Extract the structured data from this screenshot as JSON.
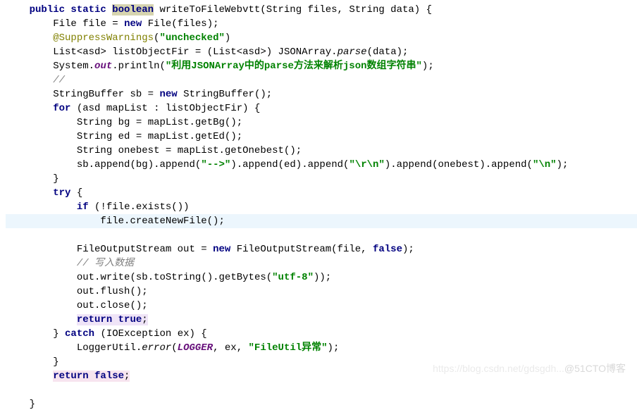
{
  "code": {
    "lines": [
      {
        "indent": "    ",
        "tokens": [
          {
            "t": "public ",
            "c": "kw"
          },
          {
            "t": "static ",
            "c": "kw"
          },
          {
            "t": "boolean",
            "c": "kw selword"
          },
          {
            "t": " ",
            "c": ""
          },
          {
            "t": "writeToFileWebvtt",
            "c": "id"
          },
          {
            "t": "(",
            "c": ""
          },
          {
            "t": "String",
            "c": "id"
          },
          {
            "t": " ",
            "c": ""
          },
          {
            "t": "files",
            "c": "id"
          },
          {
            "t": ", ",
            "c": ""
          },
          {
            "t": "String",
            "c": "id"
          },
          {
            "t": " ",
            "c": ""
          },
          {
            "t": "data",
            "c": "id"
          },
          {
            "t": ") {",
            "c": ""
          }
        ]
      },
      {
        "indent": "        ",
        "tokens": [
          {
            "t": "File",
            "c": "id"
          },
          {
            "t": " ",
            "c": ""
          },
          {
            "t": "file",
            "c": "id"
          },
          {
            "t": " = ",
            "c": ""
          },
          {
            "t": "new",
            "c": "kw"
          },
          {
            "t": " ",
            "c": ""
          },
          {
            "t": "File",
            "c": "id"
          },
          {
            "t": "(",
            "c": ""
          },
          {
            "t": "files",
            "c": "id"
          },
          {
            "t": ");",
            "c": ""
          }
        ]
      },
      {
        "indent": "        ",
        "tokens": [
          {
            "t": "@SuppressWarnings",
            "c": "annot"
          },
          {
            "t": "(",
            "c": ""
          },
          {
            "t": "\"unchecked\"",
            "c": "str"
          },
          {
            "t": ")",
            "c": ""
          }
        ]
      },
      {
        "indent": "        ",
        "tokens": [
          {
            "t": "List",
            "c": "id"
          },
          {
            "t": "<",
            "c": ""
          },
          {
            "t": "asd",
            "c": "id"
          },
          {
            "t": "> ",
            "c": ""
          },
          {
            "t": "listObjectFir",
            "c": "id"
          },
          {
            "t": " = (",
            "c": ""
          },
          {
            "t": "List",
            "c": "id"
          },
          {
            "t": "<",
            "c": ""
          },
          {
            "t": "asd",
            "c": "id"
          },
          {
            "t": ">) ",
            "c": ""
          },
          {
            "t": "JSONArray",
            "c": "id"
          },
          {
            "t": ".",
            "c": ""
          },
          {
            "t": "parse",
            "c": "callI"
          },
          {
            "t": "(",
            "c": ""
          },
          {
            "t": "data",
            "c": "id"
          },
          {
            "t": ");",
            "c": ""
          }
        ]
      },
      {
        "indent": "        ",
        "tokens": [
          {
            "t": "System",
            "c": "id"
          },
          {
            "t": ".",
            "c": ""
          },
          {
            "t": "out",
            "c": "staticb"
          },
          {
            "t": ".",
            "c": ""
          },
          {
            "t": "println",
            "c": "call"
          },
          {
            "t": "(",
            "c": ""
          },
          {
            "t": "\"利用JSONArray中的parse方法来解析json数组字符串\"",
            "c": "str"
          },
          {
            "t": ");",
            "c": ""
          }
        ]
      },
      {
        "indent": "        ",
        "tokens": [
          {
            "t": "//",
            "c": "comment"
          }
        ]
      },
      {
        "indent": "        ",
        "tokens": [
          {
            "t": "StringBuffer",
            "c": "id"
          },
          {
            "t": " ",
            "c": ""
          },
          {
            "t": "sb",
            "c": "id"
          },
          {
            "t": " = ",
            "c": ""
          },
          {
            "t": "new",
            "c": "kw"
          },
          {
            "t": " ",
            "c": ""
          },
          {
            "t": "StringBuffer",
            "c": "id"
          },
          {
            "t": "();",
            "c": ""
          }
        ]
      },
      {
        "indent": "        ",
        "tokens": [
          {
            "t": "for",
            "c": "kw"
          },
          {
            "t": " (",
            "c": ""
          },
          {
            "t": "asd",
            "c": "id"
          },
          {
            "t": " ",
            "c": ""
          },
          {
            "t": "mapList",
            "c": "id"
          },
          {
            "t": " : ",
            "c": ""
          },
          {
            "t": "listObjectFir",
            "c": "id"
          },
          {
            "t": ") {",
            "c": ""
          }
        ]
      },
      {
        "indent": "            ",
        "tokens": [
          {
            "t": "String",
            "c": "id"
          },
          {
            "t": " ",
            "c": ""
          },
          {
            "t": "bg",
            "c": "id"
          },
          {
            "t": " = ",
            "c": ""
          },
          {
            "t": "mapList",
            "c": "id"
          },
          {
            "t": ".",
            "c": ""
          },
          {
            "t": "getBg",
            "c": "call"
          },
          {
            "t": "();",
            "c": ""
          }
        ]
      },
      {
        "indent": "            ",
        "tokens": [
          {
            "t": "String",
            "c": "id"
          },
          {
            "t": " ",
            "c": ""
          },
          {
            "t": "ed",
            "c": "id"
          },
          {
            "t": " = ",
            "c": ""
          },
          {
            "t": "mapList",
            "c": "id"
          },
          {
            "t": ".",
            "c": ""
          },
          {
            "t": "getEd",
            "c": "call"
          },
          {
            "t": "();",
            "c": ""
          }
        ]
      },
      {
        "indent": "            ",
        "tokens": [
          {
            "t": "String",
            "c": "id"
          },
          {
            "t": " ",
            "c": ""
          },
          {
            "t": "onebest",
            "c": "id"
          },
          {
            "t": " = ",
            "c": ""
          },
          {
            "t": "mapList",
            "c": "id"
          },
          {
            "t": ".",
            "c": ""
          },
          {
            "t": "getOnebest",
            "c": "call"
          },
          {
            "t": "();",
            "c": ""
          }
        ]
      },
      {
        "indent": "            ",
        "tokens": [
          {
            "t": "sb",
            "c": "id"
          },
          {
            "t": ".",
            "c": ""
          },
          {
            "t": "append",
            "c": "call"
          },
          {
            "t": "(",
            "c": ""
          },
          {
            "t": "bg",
            "c": "id"
          },
          {
            "t": ").",
            "c": ""
          },
          {
            "t": "append",
            "c": "call"
          },
          {
            "t": "(",
            "c": ""
          },
          {
            "t": "\"-->\"",
            "c": "str"
          },
          {
            "t": ").",
            "c": ""
          },
          {
            "t": "append",
            "c": "call"
          },
          {
            "t": "(",
            "c": ""
          },
          {
            "t": "ed",
            "c": "id"
          },
          {
            "t": ").",
            "c": ""
          },
          {
            "t": "append",
            "c": "call"
          },
          {
            "t": "(",
            "c": ""
          },
          {
            "t": "\"\\r\\n\"",
            "c": "str"
          },
          {
            "t": ").",
            "c": ""
          },
          {
            "t": "append",
            "c": "call"
          },
          {
            "t": "(",
            "c": ""
          },
          {
            "t": "onebest",
            "c": "id"
          },
          {
            "t": ").",
            "c": ""
          },
          {
            "t": "append",
            "c": "call"
          },
          {
            "t": "(",
            "c": ""
          },
          {
            "t": "\"\\n\"",
            "c": "str"
          },
          {
            "t": ");",
            "c": ""
          }
        ]
      },
      {
        "indent": "        ",
        "tokens": [
          {
            "t": "}",
            "c": ""
          }
        ]
      },
      {
        "indent": "        ",
        "tokens": [
          {
            "t": "try",
            "c": "kw"
          },
          {
            "t": " {",
            "c": ""
          }
        ]
      },
      {
        "indent": "            ",
        "tokens": [
          {
            "t": "if",
            "c": "kw"
          },
          {
            "t": " (!",
            "c": ""
          },
          {
            "t": "file",
            "c": "id"
          },
          {
            "t": ".",
            "c": ""
          },
          {
            "t": "exists",
            "c": "call"
          },
          {
            "t": "())",
            "c": ""
          }
        ]
      },
      {
        "hl": true,
        "indent": "                ",
        "tokens": [
          {
            "t": "file",
            "c": "id"
          },
          {
            "t": ".",
            "c": ""
          },
          {
            "t": "createNewFile",
            "c": "call"
          },
          {
            "t": "();",
            "c": ""
          }
        ]
      },
      {
        "indent": "",
        "tokens": []
      },
      {
        "indent": "            ",
        "tokens": [
          {
            "t": "FileOutputStream",
            "c": "id"
          },
          {
            "t": " ",
            "c": ""
          },
          {
            "t": "out",
            "c": "id"
          },
          {
            "t": " = ",
            "c": ""
          },
          {
            "t": "new",
            "c": "kw"
          },
          {
            "t": " ",
            "c": ""
          },
          {
            "t": "FileOutputStream",
            "c": "id"
          },
          {
            "t": "(",
            "c": ""
          },
          {
            "t": "file",
            "c": "id"
          },
          {
            "t": ", ",
            "c": ""
          },
          {
            "t": "false",
            "c": "kw"
          },
          {
            "t": ");",
            "c": ""
          }
        ]
      },
      {
        "indent": "            ",
        "tokens": [
          {
            "t": "// 写入数据",
            "c": "comment"
          }
        ]
      },
      {
        "indent": "            ",
        "tokens": [
          {
            "t": "out",
            "c": "id"
          },
          {
            "t": ".",
            "c": ""
          },
          {
            "t": "write",
            "c": "call"
          },
          {
            "t": "(",
            "c": ""
          },
          {
            "t": "sb",
            "c": "id"
          },
          {
            "t": ".",
            "c": ""
          },
          {
            "t": "toString",
            "c": "call"
          },
          {
            "t": "().",
            "c": ""
          },
          {
            "t": "getBytes",
            "c": "call"
          },
          {
            "t": "(",
            "c": ""
          },
          {
            "t": "\"utf-8\"",
            "c": "str"
          },
          {
            "t": "));",
            "c": ""
          }
        ]
      },
      {
        "indent": "            ",
        "tokens": [
          {
            "t": "out",
            "c": "id"
          },
          {
            "t": ".",
            "c": ""
          },
          {
            "t": "flush",
            "c": "call"
          },
          {
            "t": "();",
            "c": ""
          }
        ]
      },
      {
        "indent": "            ",
        "tokens": [
          {
            "t": "out",
            "c": "id"
          },
          {
            "t": ".",
            "c": ""
          },
          {
            "t": "close",
            "c": "call"
          },
          {
            "t": "();",
            "c": ""
          }
        ]
      },
      {
        "indent": "            ",
        "tokens": [
          {
            "t": "return true",
            "c": "kw mark"
          },
          {
            "t": ";",
            "c": "mark"
          }
        ]
      },
      {
        "indent": "        ",
        "tokens": [
          {
            "t": "} ",
            "c": ""
          },
          {
            "t": "catch",
            "c": "kw"
          },
          {
            "t": " (",
            "c": ""
          },
          {
            "t": "IOException",
            "c": "id"
          },
          {
            "t": " ",
            "c": ""
          },
          {
            "t": "ex",
            "c": "id"
          },
          {
            "t": ") {",
            "c": ""
          }
        ]
      },
      {
        "indent": "            ",
        "tokens": [
          {
            "t": "LoggerUtil",
            "c": "id"
          },
          {
            "t": ".",
            "c": ""
          },
          {
            "t": "error",
            "c": "callI"
          },
          {
            "t": "(",
            "c": ""
          },
          {
            "t": "LOGGER",
            "c": "staticb"
          },
          {
            "t": ", ",
            "c": ""
          },
          {
            "t": "ex",
            "c": "id"
          },
          {
            "t": ", ",
            "c": ""
          },
          {
            "t": "\"FileUtil异常\"",
            "c": "str"
          },
          {
            "t": ");",
            "c": ""
          }
        ]
      },
      {
        "indent": "        ",
        "tokens": [
          {
            "t": "}",
            "c": ""
          }
        ]
      },
      {
        "indent": "        ",
        "tokens": [
          {
            "t": "return false",
            "c": "kw exitmark"
          },
          {
            "t": ";",
            "c": "exitmark"
          }
        ]
      },
      {
        "indent": "",
        "tokens": []
      },
      {
        "indent": "    ",
        "tokens": [
          {
            "t": "}",
            "c": ""
          }
        ]
      }
    ]
  },
  "watermark": {
    "faint": "https://blog.csdn.net/gdsgdh...",
    "main": "@51CTO博客"
  }
}
